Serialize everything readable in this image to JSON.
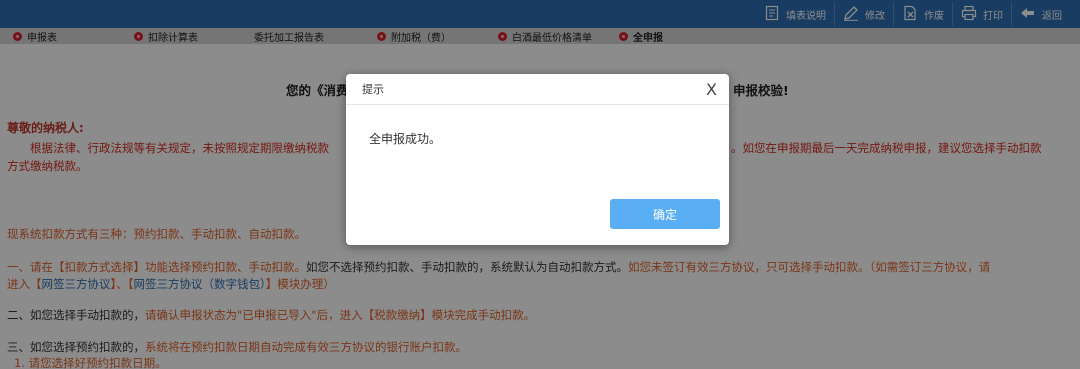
{
  "toolbar": {
    "items": [
      {
        "label": "填表说明",
        "icon": "document-icon"
      },
      {
        "label": "修改",
        "icon": "pencil-icon"
      },
      {
        "label": "作废",
        "icon": "void-document-icon"
      },
      {
        "label": "打印",
        "icon": "printer-icon"
      },
      {
        "label": "返回",
        "icon": "back-arrow-icon"
      }
    ]
  },
  "tabs": [
    {
      "label": "申报表",
      "has_dot": true
    },
    {
      "label": "扣除计算表",
      "has_dot": true
    },
    {
      "label": "委托加工报告表",
      "has_dot": false
    },
    {
      "label": "附加税（费）",
      "has_dot": true
    },
    {
      "label": "白酒最低价格清单",
      "has_dot": true
    },
    {
      "label": "全申报",
      "has_dot": true,
      "active": true
    }
  ],
  "content": {
    "title_left": "您的《消费",
    "title_right": "申报校验!",
    "salute": "尊敬的纳税人:",
    "p1_left": "根据法律、行政法规等有关规定，未按照规定期限缴纳税款",
    "p1_right": "。如您在申报期最后一天完成纳税申报，建议您选择手动扣款",
    "p1_line2": "方式缴纳税款。",
    "p2": "现系统扣款方式有三种：预约扣款、手动扣款、自动扣款。",
    "p3_a": "一、请在【扣款方式选择】功能选择预约扣款、手动扣款。",
    "p3_b": "如您不选择预约扣款、手动扣款的，系统默认为自动扣款方式。",
    "p3_c": "如您未签订有效三方协议，只可选择手动扣款。（如需签订三方协议，请",
    "p3_line2_a": "进入【",
    "p3_link1": "网签三方协议",
    "p3_line2_b": "】、【",
    "p3_link2": "网签三方协议（数字钱包）",
    "p3_line2_c": "】模块办理）",
    "p4_a": "二、如您选择手动扣款的，",
    "p4_b": "请确认申报状态为\"已申报已导入\"后，进入【税款缴纳】模块完成手动扣款。",
    "p5_a": "三、如您选择预约扣款的，",
    "p5_b": "系统将在预约扣款日期自动完成有效三方协议的银行账户扣款。",
    "p5_line2": "1. 请您选择好预约扣款日期。"
  },
  "dialog": {
    "title": "提示",
    "close": "X",
    "message": "全申报成功。",
    "confirm": "确定"
  },
  "colors": {
    "topbar": "#2f6fb2",
    "tabsbar": "#d6d6d6",
    "tab_dot": "#d6202a",
    "confirm_button": "#5aaef3",
    "warning_red": "#d42c1e"
  }
}
